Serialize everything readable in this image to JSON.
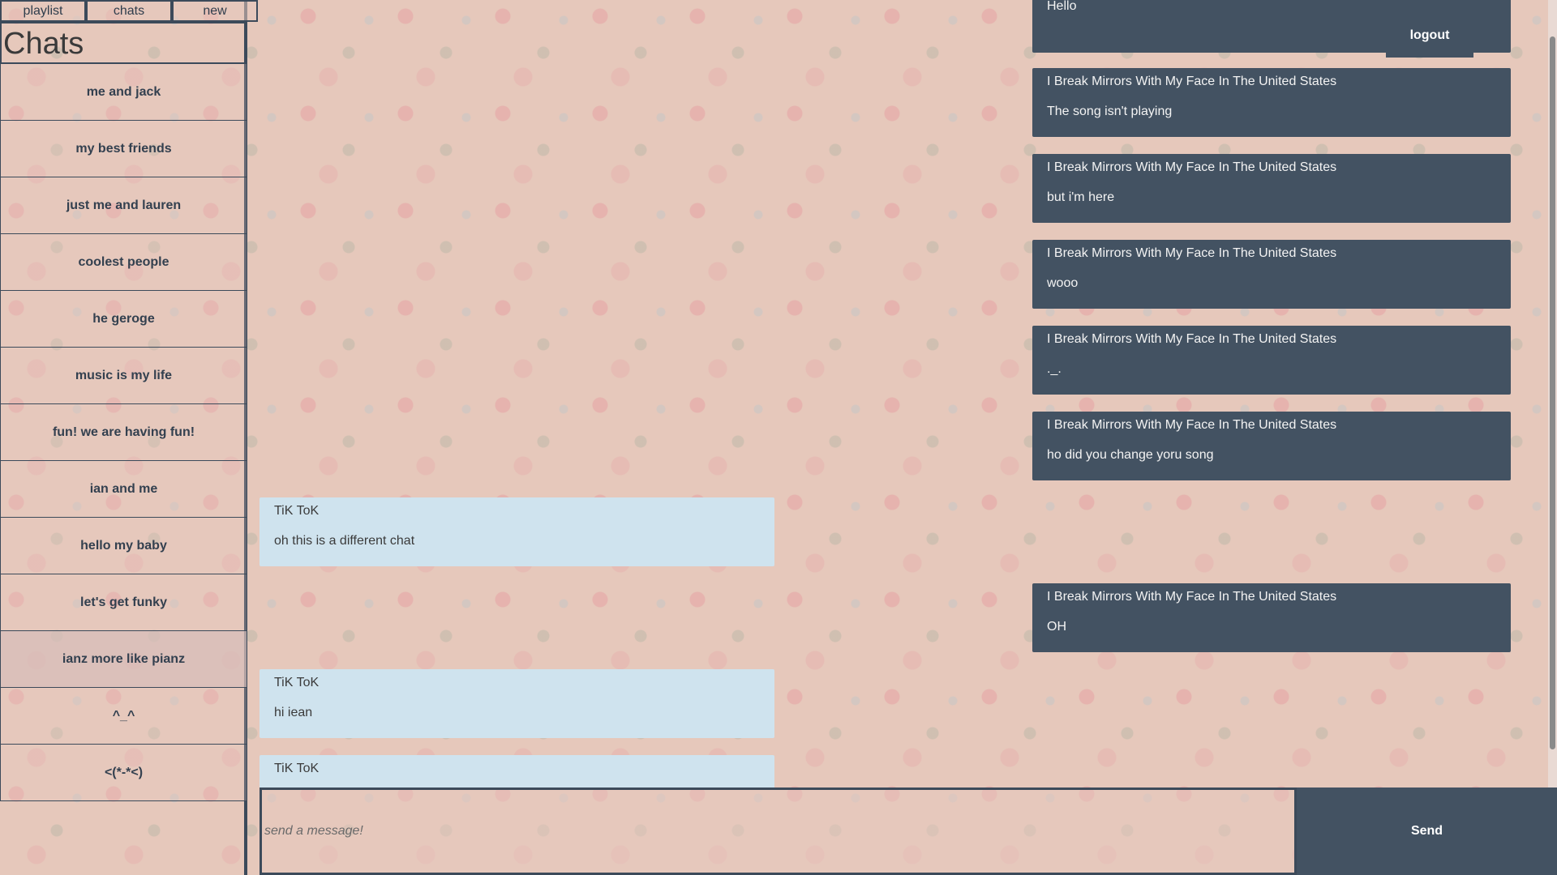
{
  "nav": {
    "playlist": "playlist",
    "chats": "chats",
    "new": "new"
  },
  "sidebar": {
    "title": "Chats",
    "chats": [
      "me and jack",
      "my best friends",
      "just me and lauren",
      "coolest people",
      "he geroge",
      "music is my life",
      "fun! we are having fun!",
      "ian and me",
      "hello my baby",
      "let's get funky",
      "ianz more like pianz",
      "^_^",
      "<(*-*<)"
    ],
    "active_index": 10
  },
  "logout_label": "logout",
  "messages": [
    {
      "sender": "",
      "text": "Hello",
      "mine": true
    },
    {
      "sender": "I Break Mirrors With My Face In The United States",
      "text": "The song isn't playing",
      "mine": true
    },
    {
      "sender": "I Break Mirrors With My Face In The United States",
      "text": "but i'm here",
      "mine": true
    },
    {
      "sender": "I Break Mirrors With My Face In The United States",
      "text": "wooo",
      "mine": true
    },
    {
      "sender": "I Break Mirrors With My Face In The United States",
      "text": "._.",
      "mine": true
    },
    {
      "sender": "I Break Mirrors With My Face In The United States",
      "text": "ho did you change yoru song",
      "mine": true
    },
    {
      "sender": "TiK ToK",
      "text": "oh this is a different chat",
      "mine": false
    },
    {
      "sender": "I Break Mirrors With My Face In The United States",
      "text": "OH",
      "mine": true
    },
    {
      "sender": "TiK ToK",
      "text": "hi iean",
      "mine": false
    },
    {
      "sender": "TiK ToK",
      "text": "",
      "mine": false
    }
  ],
  "compose": {
    "placeholder": "send a message!",
    "send_label": "Send"
  }
}
